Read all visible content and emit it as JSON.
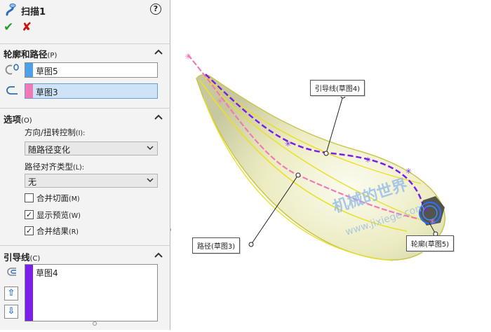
{
  "panel": {
    "title": "扫描1",
    "help_label": "?",
    "profile_section": {
      "title": "轮廓和路径",
      "shortcut": "(P)",
      "profile_value": "草图5",
      "path_value": "草图3",
      "profile_color": "#4ea0e8",
      "path_color": "#f07ab8"
    },
    "options_section": {
      "title": "选项",
      "shortcut": "(O)",
      "orientation_label": "方向/扭转控制",
      "orientation_shortcut": "(I):",
      "orientation_value": "随路径变化",
      "alignment_label": "路径对齐类型",
      "alignment_shortcut": "(L):",
      "alignment_value": "无",
      "checkboxes": [
        {
          "label": "合并切面",
          "shortcut": "(M)",
          "checked": false
        },
        {
          "label": "显示预览",
          "shortcut": "(W)",
          "checked": true
        },
        {
          "label": "合并结果",
          "shortcut": "(R)",
          "checked": true
        }
      ]
    },
    "guide_section": {
      "title": "引导线",
      "shortcut": "(C)",
      "items": [
        "草图4"
      ],
      "guide_color": "#7a1fe8"
    }
  },
  "viewport": {
    "callouts": {
      "guide": "引导线(草图4)",
      "path": "路径(草图3)",
      "profile": "轮廓(草图5)"
    },
    "watermark_top": "机械的世界",
    "watermark_bottom": "www.jixiege.com"
  }
}
